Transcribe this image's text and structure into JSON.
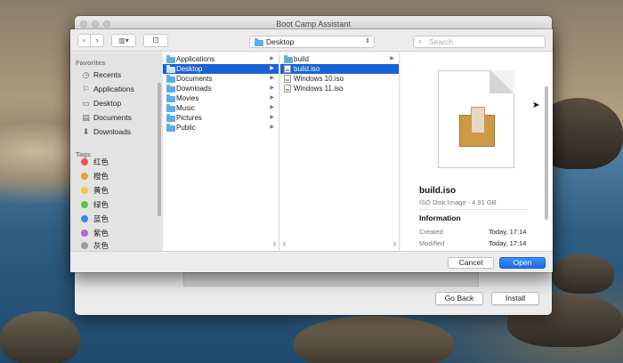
{
  "window": {
    "title": "Boot Camp Assistant",
    "back_label": "Go Back",
    "install_label": "Install"
  },
  "toolbar": {
    "back_glyph": "‹",
    "forward_glyph": "›",
    "view_glyph": "▥▾",
    "new_folder_glyph": "⊡",
    "location": "Desktop",
    "location_glyph": "⇕",
    "search_placeholder": "Search"
  },
  "sidebar": {
    "favorites_label": "Favorites",
    "favorites": [
      {
        "label": "Recents",
        "icon": "clock-icon",
        "glyph": "◷"
      },
      {
        "label": "Applications",
        "icon": "applications-icon",
        "glyph": "⚐"
      },
      {
        "label": "Desktop",
        "icon": "desktop-icon",
        "glyph": "▭"
      },
      {
        "label": "Documents",
        "icon": "documents-icon",
        "glyph": "▤"
      },
      {
        "label": "Downloads",
        "icon": "downloads-icon",
        "glyph": "⬇"
      }
    ],
    "tags_label": "Tags",
    "tags": [
      {
        "label": "红色",
        "color": "#f0524f"
      },
      {
        "label": "橙色",
        "color": "#f39b37"
      },
      {
        "label": "黄色",
        "color": "#f5cc3e"
      },
      {
        "label": "绿色",
        "color": "#5fc04f"
      },
      {
        "label": "蓝色",
        "color": "#3d86f0"
      },
      {
        "label": "紫色",
        "color": "#b26ad1"
      },
      {
        "label": "灰色",
        "color": "#9a9a9a"
      }
    ]
  },
  "column1": {
    "items": [
      {
        "label": "Applications",
        "selected": false
      },
      {
        "label": "Desktop",
        "selected": true
      },
      {
        "label": "Documents",
        "selected": false
      },
      {
        "label": "Downloads",
        "selected": false
      },
      {
        "label": "Movies",
        "selected": false
      },
      {
        "label": "Music",
        "selected": false
      },
      {
        "label": "Pictures",
        "selected": false
      },
      {
        "label": "Public",
        "selected": false
      }
    ]
  },
  "column2": {
    "items": [
      {
        "label": "build",
        "type": "folder",
        "selected": false
      },
      {
        "label": "build.iso",
        "type": "iso",
        "selected": true
      },
      {
        "label": "Windows 10.iso",
        "type": "iso",
        "selected": false
      },
      {
        "label": "Windows 11.iso",
        "type": "iso",
        "selected": false
      }
    ]
  },
  "preview": {
    "name": "build.iso",
    "kind": "ISO Disk Image - 4.91 GB",
    "info_label": "Information",
    "created_label": "Created",
    "created_value": "Today, 17:14",
    "modified_label": "Modified",
    "modified_value": "Today, 17:14"
  },
  "buttons": {
    "cancel": "Cancel",
    "open": "Open"
  },
  "colors": {
    "accent": "#1a63d6",
    "open_button": "#1d6ce8"
  }
}
